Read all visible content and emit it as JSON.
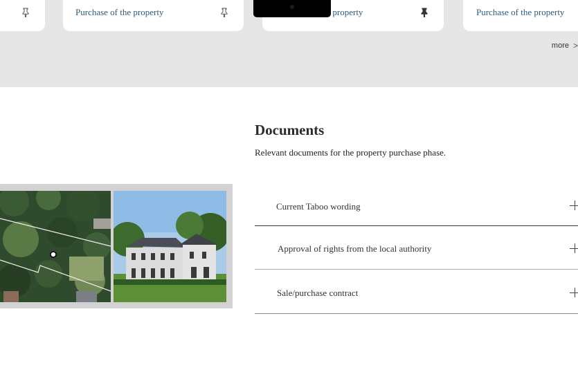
{
  "top_cards": {
    "card1_label": "",
    "card2_label": "Purchase of the property",
    "card3_label": "Purchase of the property",
    "card4_label": "Purchase of the property",
    "icon": "pin-icon"
  },
  "more_link": {
    "label": "more",
    "chevron": ">"
  },
  "documents": {
    "title": "Documents",
    "subtitle": "Relevant documents for the property purchase phase.",
    "items": [
      {
        "label": "Current Taboo wording"
      },
      {
        "label": "Approval of rights from the local authority"
      },
      {
        "label": "Sale/purchase contract"
      }
    ]
  },
  "colors": {
    "band": "#e6e6e6",
    "link": "#2f5a7a",
    "text": "#2b2b2b"
  }
}
